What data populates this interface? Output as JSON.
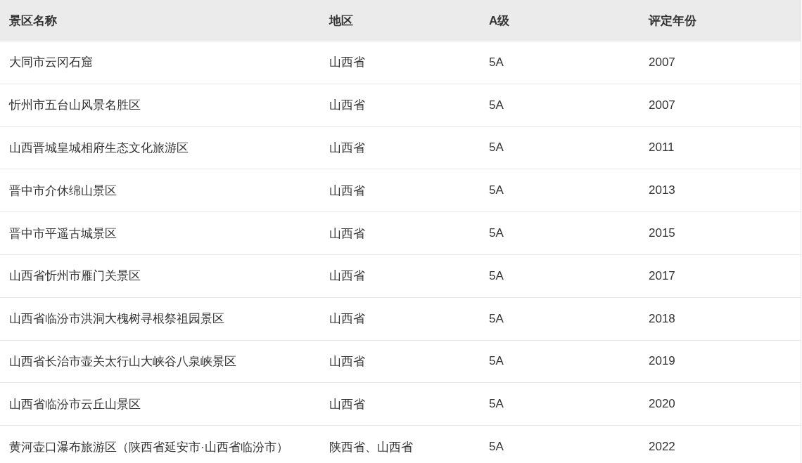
{
  "table": {
    "columns": [
      "景区名称",
      "地区",
      "A级",
      "评定年份"
    ],
    "rows": [
      [
        "大同市云冈石窟",
        "山西省",
        "5A",
        "2007"
      ],
      [
        "忻州市五台山风景名胜区",
        "山西省",
        "5A",
        "2007"
      ],
      [
        "山西晋城皇城相府生态文化旅游区",
        "山西省",
        "5A",
        "2011"
      ],
      [
        "晋中市介休绵山景区",
        "山西省",
        "5A",
        "2013"
      ],
      [
        "晋中市平遥古城景区",
        "山西省",
        "5A",
        "2015"
      ],
      [
        "山西省忻州市雁门关景区",
        "山西省",
        "5A",
        "2017"
      ],
      [
        "山西省临汾市洪洞大槐树寻根祭祖园景区",
        "山西省",
        "5A",
        "2018"
      ],
      [
        "山西省长治市壶关太行山大峡谷八泉峡景区",
        "山西省",
        "5A",
        "2019"
      ],
      [
        "山西省临汾市云丘山景区",
        "山西省",
        "5A",
        "2020"
      ],
      [
        "黄河壶口瀑布旅游区（陕西省延安市·山西省临汾市）",
        "陕西省、山西省",
        "5A",
        "2022"
      ]
    ]
  }
}
